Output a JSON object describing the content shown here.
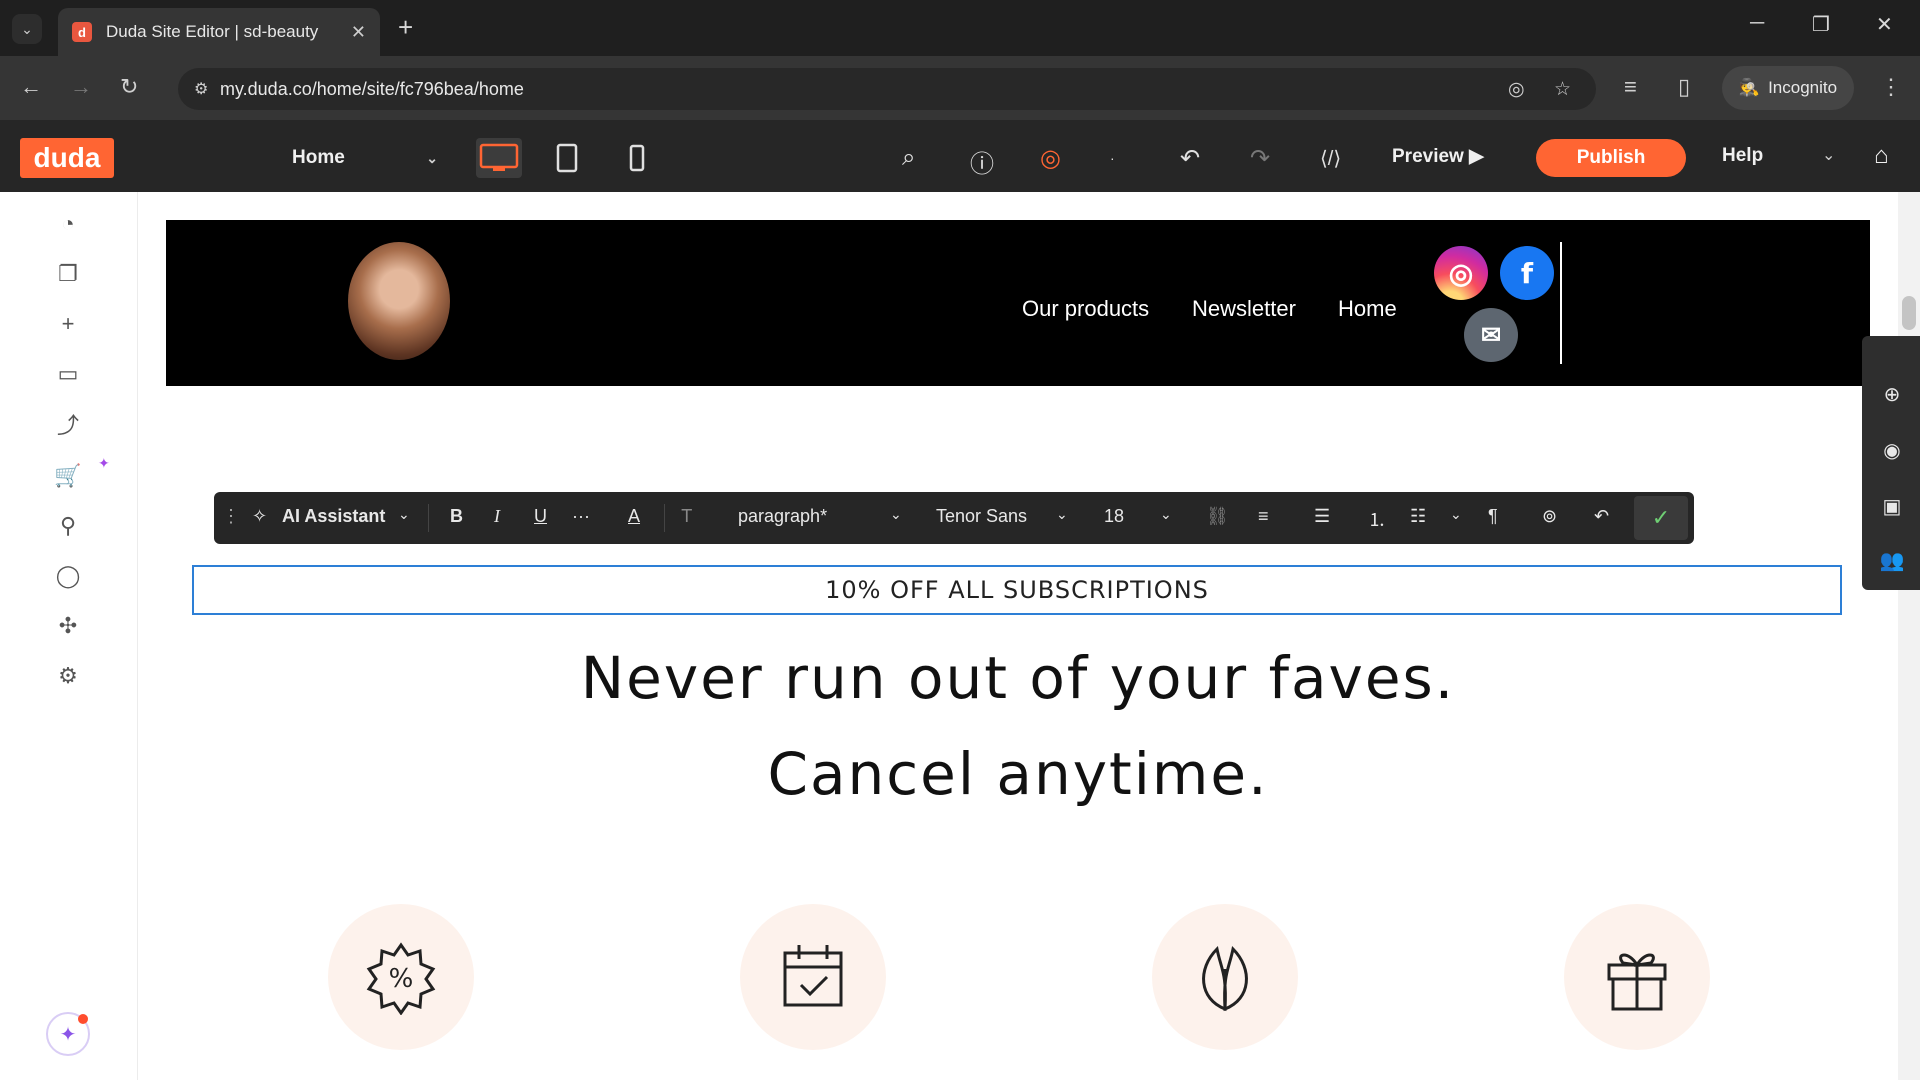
{
  "browser": {
    "tab_title": "Duda Site Editor | sd-beauty",
    "tab_favicon": "d",
    "url": "my.duda.co/home/site/fc796bea/home",
    "incognito_label": "Incognito"
  },
  "duda": {
    "logo": "duda",
    "page_select": "Home",
    "preview_label": "Preview",
    "publish_label": "Publish",
    "help_label": "Help",
    "accent": "#ff6533"
  },
  "toolbar": {
    "ai_assistant": "AI Assistant",
    "text_style": "paragraph*",
    "font": "Tenor Sans",
    "size": "18"
  },
  "site": {
    "nav": [
      "Our products",
      "Newsletter",
      "Home"
    ],
    "promo": "10% OFF ALL SUBSCRIPTIONS",
    "headline_1": "Never run out of your faves.",
    "headline_2": "Cancel anytime."
  },
  "icons": {
    "features": [
      "discount-badge-icon",
      "calendar-check-icon",
      "leaf-icon",
      "gift-icon"
    ]
  }
}
